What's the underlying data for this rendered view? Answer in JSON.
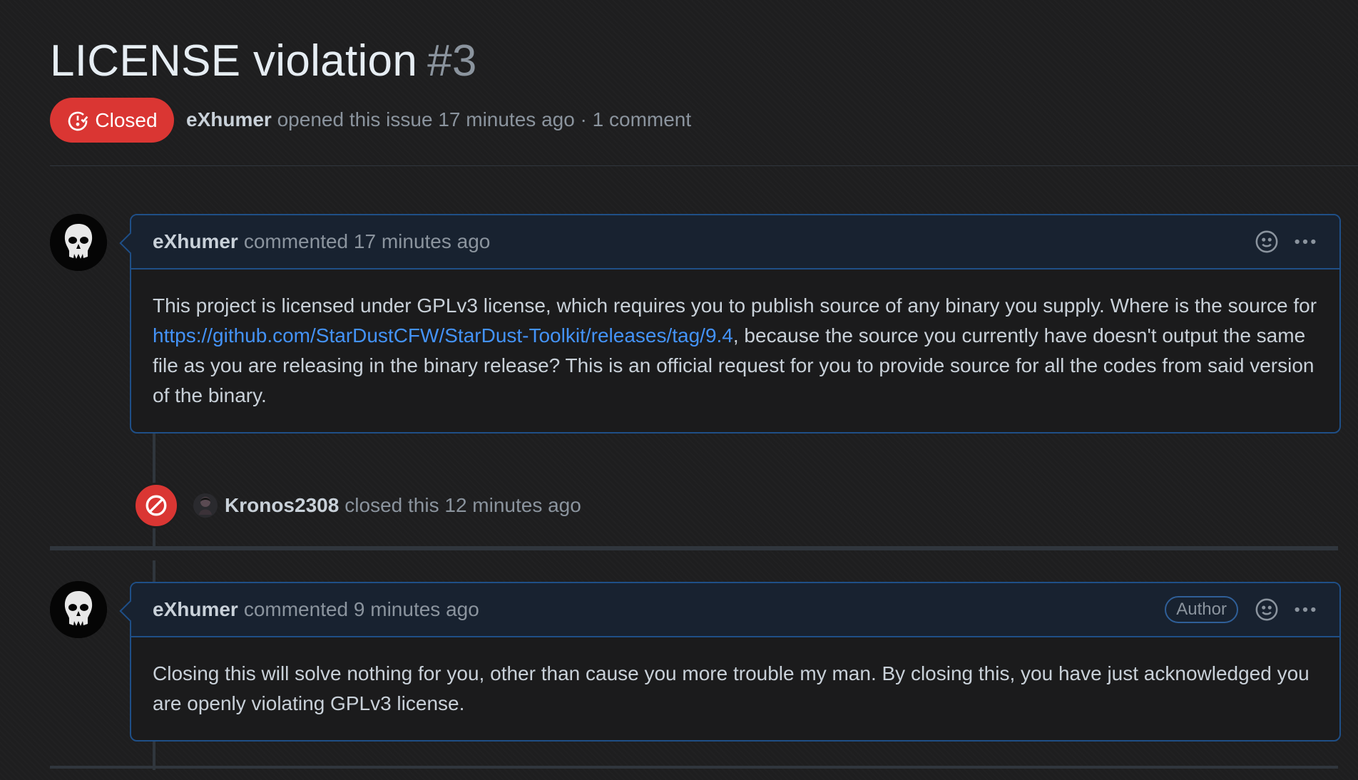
{
  "issue": {
    "title": "LICENSE violation",
    "number": "#3",
    "state": "Closed",
    "opened_by": "eXhumer",
    "opened_text": "opened this issue 17 minutes ago · 1 comment"
  },
  "comments": [
    {
      "author": "eXhumer",
      "action": "commented",
      "time": "17 minutes ago",
      "badge": "",
      "body_before_link": "This project is licensed under GPLv3 license, which requires you to publish source of any binary you supply. Where is the source for ",
      "link": "https://github.com/StarDustCFW/StarDust-Toolkit/releases/tag/9.4",
      "body_after_link": ", because the source you currently have doesn't output the same file as you are releasing in the binary release? This is an official request for you to provide source for all the codes from said version of the binary."
    },
    {
      "author": "eXhumer",
      "action": "commented",
      "time": "9 minutes ago",
      "badge": "Author",
      "body": "Closing this will solve nothing for you, other than cause you more trouble my man. By closing this, you have just acknowledged you are openly violating GPLv3 license."
    }
  ],
  "close_event": {
    "actor": "Kronos2308",
    "text": "closed this 12 minutes ago"
  },
  "icons": {
    "state": "issue-closed-icon",
    "reaction": "smiley-icon",
    "more": "kebab-horizontal-icon",
    "event": "circle-slash-icon"
  },
  "colors": {
    "closed_red": "#da3633",
    "link_blue": "#4493f8",
    "comment_border": "#1f4f87"
  }
}
